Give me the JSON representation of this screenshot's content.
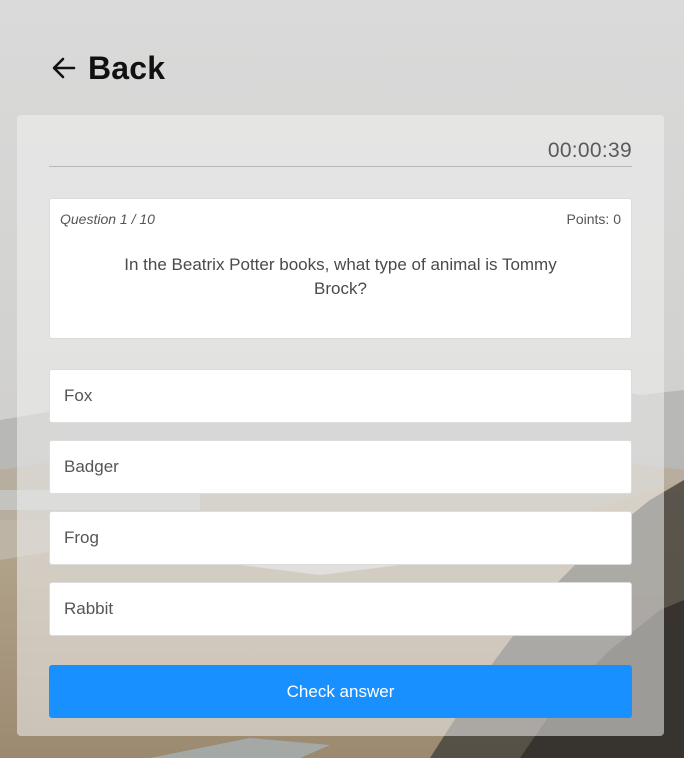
{
  "nav": {
    "back_label": "Back",
    "back_icon": "arrow-left-icon"
  },
  "quiz": {
    "timer": "00:00:39",
    "question_counter": "Question 1 / 10",
    "points": "Points: 0",
    "question_text": "In the Beatrix Potter books, what type of animal is Tommy Brock?",
    "answers": [
      "Fox",
      "Badger",
      "Frog",
      "Rabbit"
    ],
    "check_button_label": "Check answer"
  },
  "colors": {
    "accent": "#1890ff",
    "card_background": "rgba(240,240,240,0.55)",
    "text": "#4a4a4a"
  }
}
